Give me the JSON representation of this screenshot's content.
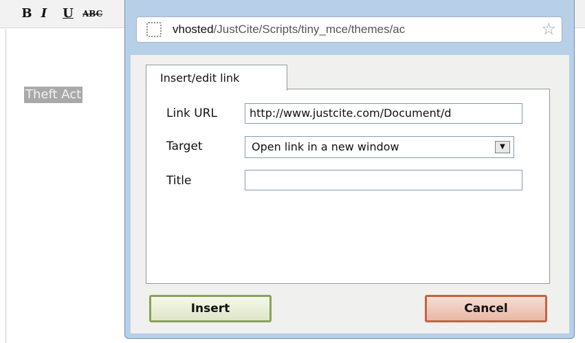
{
  "editor": {
    "toolbar": {
      "bold": "B",
      "italic": "I",
      "underline": "U",
      "strikethrough": "ABC"
    },
    "content_text": "Theft Act"
  },
  "browser_popup": {
    "address_bar": {
      "url_host": "vhosted",
      "url_path": "/JustCite/Scripts/tiny_mce/themes/ac"
    },
    "dialog": {
      "tab_label": "Insert/edit link",
      "fields": {
        "link_url_label": "Link URL",
        "link_url_value": "http://www.justcite.com/Document/d",
        "target_label": "Target",
        "target_value": "Open link in a new window",
        "title_label": "Title",
        "title_value": ""
      },
      "buttons": {
        "insert": "Insert",
        "cancel": "Cancel"
      }
    }
  },
  "colors": {
    "popup_frame": "#b8cfe8",
    "insert_border": "#8aa05b",
    "cancel_border": "#c4633f"
  }
}
